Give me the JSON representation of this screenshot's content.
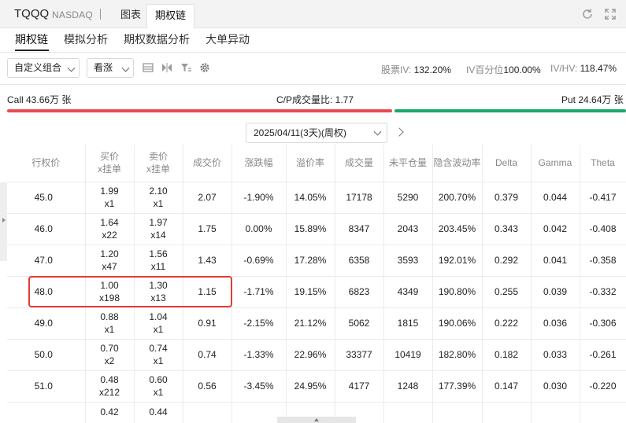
{
  "header": {
    "symbol": "TQQQ",
    "exchange": "NASDAQ",
    "tabs": [
      "图表",
      "期权链"
    ]
  },
  "subtabs": [
    "期权链",
    "模拟分析",
    "期权数据分析",
    "大单异动"
  ],
  "toolbar": {
    "combo_dropdown": "自定义组合",
    "direction_dropdown": "看涨",
    "metrics": [
      {
        "label": "股票IV:",
        "value": "132.20%"
      },
      {
        "label": "IV百分位",
        "value": "100.00%"
      },
      {
        "label": "IV/HV:",
        "value": "118.47%"
      }
    ]
  },
  "cp": {
    "call": "Call 43.66万 张",
    "ratio": "C/P成交量比: 1.77",
    "put": "Put 24.64万 张",
    "call_share": 0.64
  },
  "expiry": "2025/04/11(3天)(周权)",
  "table": {
    "headers": [
      "行权价",
      "买价\nx挂单",
      "卖价\nx挂单",
      "成交价",
      "涨跌幅",
      "溢价率",
      "成交量",
      "未平仓量",
      "隐含波动率",
      "Delta",
      "Gamma",
      "Theta"
    ],
    "rows": [
      {
        "strike": "45.0",
        "bid": "1.99",
        "bid_size": "x1",
        "ask": "2.10",
        "ask_size": "x1",
        "last": "2.07",
        "change": "-1.90%",
        "premium": "14.05%",
        "volume": "17178",
        "oi": "5290",
        "iv": "200.70%",
        "delta": "0.379",
        "gamma": "0.044",
        "theta": "-0.417"
      },
      {
        "strike": "46.0",
        "bid": "1.64",
        "bid_size": "x22",
        "ask": "1.97",
        "ask_size": "x14",
        "last": "1.75",
        "change": "0.00%",
        "premium": "15.89%",
        "volume": "8347",
        "oi": "2043",
        "iv": "203.45%",
        "delta": "0.343",
        "gamma": "0.042",
        "theta": "-0.408"
      },
      {
        "strike": "47.0",
        "bid": "1.20",
        "bid_size": "x47",
        "ask": "1.56",
        "ask_size": "x11",
        "last": "1.43",
        "change": "-0.69%",
        "premium": "17.28%",
        "volume": "6358",
        "oi": "3593",
        "iv": "192.01%",
        "delta": "0.292",
        "gamma": "0.041",
        "theta": "-0.358"
      },
      {
        "strike": "48.0",
        "bid": "1.00",
        "bid_size": "x198",
        "ask": "1.30",
        "ask_size": "x13",
        "last": "1.15",
        "change": "-1.71%",
        "premium": "19.15%",
        "volume": "6823",
        "oi": "4349",
        "iv": "190.80%",
        "delta": "0.255",
        "gamma": "0.039",
        "theta": "-0.332"
      },
      {
        "strike": "49.0",
        "bid": "0.88",
        "bid_size": "x1",
        "ask": "1.04",
        "ask_size": "x1",
        "last": "0.91",
        "change": "-2.15%",
        "premium": "21.12%",
        "volume": "5062",
        "oi": "1815",
        "iv": "190.06%",
        "delta": "0.222",
        "gamma": "0.036",
        "theta": "-0.306"
      },
      {
        "strike": "50.0",
        "bid": "0.70",
        "bid_size": "x2",
        "ask": "0.74",
        "ask_size": "x1",
        "last": "0.74",
        "change": "-1.33%",
        "premium": "22.96%",
        "volume": "33377",
        "oi": "10419",
        "iv": "182.80%",
        "delta": "0.182",
        "gamma": "0.033",
        "theta": "-0.261"
      },
      {
        "strike": "51.0",
        "bid": "0.48",
        "bid_size": "x212",
        "ask": "0.60",
        "ask_size": "x1",
        "last": "0.56",
        "change": "-3.45%",
        "premium": "24.95%",
        "volume": "4177",
        "oi": "1248",
        "iv": "177.39%",
        "delta": "0.147",
        "gamma": "0.030",
        "theta": "-0.220"
      }
    ],
    "partial_row": {
      "bid": "0.42",
      "ask": "0.44"
    }
  },
  "colors": {
    "call_bar": "#e84a4f",
    "put_bar": "#1ba76a",
    "negative_change": "#1ba76a",
    "highlight": "#e63a35"
  }
}
